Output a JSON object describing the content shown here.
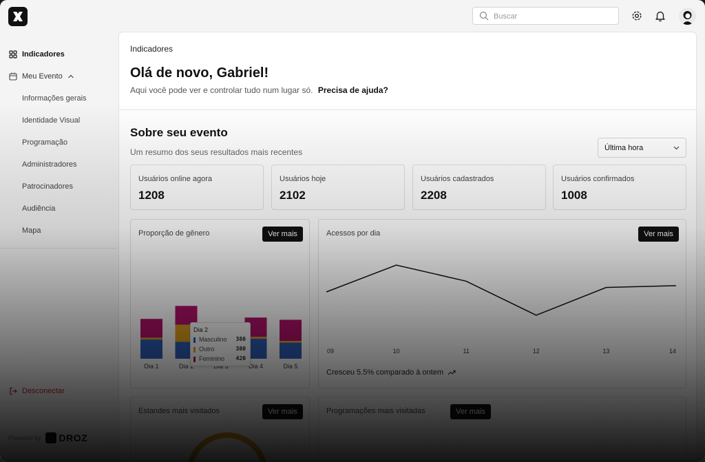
{
  "topbar": {
    "search_placeholder": "Buscar",
    "icons": [
      "logo-icon",
      "search-icon",
      "gear-icon",
      "bell-icon",
      "avatar"
    ]
  },
  "sidebar": {
    "items": [
      {
        "label": "Indicadores",
        "icon": "grid-icon",
        "active": true
      },
      {
        "label": "Meu Evento",
        "icon": "calendar-icon",
        "expanded": true
      }
    ],
    "subitems": [
      "Informações gerais",
      "Identidade Visual",
      "Programação",
      "Administradores",
      "Patrocinadores",
      "Audiência",
      "Mapa"
    ],
    "logout_label": "Desconectar",
    "powered_by": "Powered by",
    "brand": "DROZ"
  },
  "main": {
    "breadcrumb": "Indicadores",
    "greeting": "Olá de novo, Gabriel!",
    "subtitle": "Aqui você pode ver e controlar tudo num lugar só.",
    "help_link": "Precisa de ajuda?",
    "section_title": "Sobre seu evento",
    "section_subtitle": "Um resumo dos seus resultados mais recentes",
    "period_select": "Última hora",
    "stats": [
      {
        "label": "Usuários online agora",
        "value": "1208"
      },
      {
        "label": "Usuários hoje",
        "value": "2102"
      },
      {
        "label": "Usuários cadastrados",
        "value": "2208"
      },
      {
        "label": "Usuários confirmados",
        "value": "1008"
      }
    ],
    "see_more": "Ver mais",
    "gender_card_title": "Proporção de gênero",
    "access_card_title": "Acessos por dia",
    "growth_text": "Cresceu 5.5% comparado à ontem",
    "bottom_cards": [
      "Estandes mais visitados",
      "Programações mais visitadas"
    ],
    "tooltip": {
      "title": "Dia 2",
      "rows": [
        {
          "name": "Masculino",
          "value": "380"
        },
        {
          "name": "Outro",
          "value": "380"
        },
        {
          "name": "Feminino",
          "value": "420"
        }
      ]
    }
  },
  "colors": {
    "masculino": "#2e5eb8",
    "outro": "#e0a020",
    "feminino": "#b3126b",
    "danger": "#c01e2e"
  },
  "chart_data": [
    {
      "type": "bar",
      "stacked": true,
      "title": "Proporção de gênero",
      "categories": [
        "Dia 1",
        "Dia 2",
        "Dia 3",
        "Dia 4",
        "Dia 5"
      ],
      "series": [
        {
          "name": "Masculino",
          "values": [
            430,
            380,
            290,
            450,
            360
          ]
        },
        {
          "name": "Outro",
          "values": [
            40,
            380,
            10,
            40,
            40
          ]
        },
        {
          "name": "Feminino",
          "values": [
            420,
            420,
            290,
            430,
            470
          ]
        }
      ]
    },
    {
      "type": "line",
      "title": "Acessos por dia",
      "x": [
        "09",
        "10",
        "11",
        "12",
        "13",
        "14"
      ],
      "values": [
        50,
        80,
        62,
        24,
        55,
        57
      ],
      "ylim": [
        0,
        100
      ],
      "grid": false
    }
  ]
}
